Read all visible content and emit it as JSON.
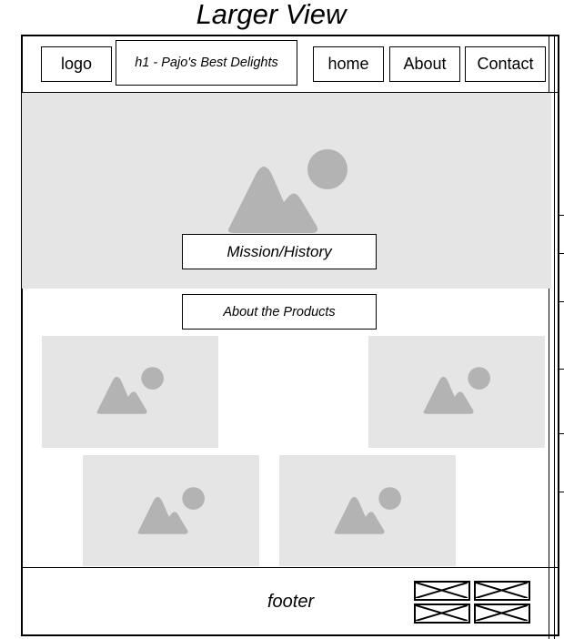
{
  "page": {
    "title": "Larger View"
  },
  "header": {
    "logo_label": "logo",
    "h1_label": "h1 - Pajo's Best Delights",
    "nav": {
      "home": "home",
      "about": "About",
      "contact": "Contact"
    }
  },
  "hero": {
    "image_icon": "image-placeholder-icon",
    "mission_label": "Mission/History"
  },
  "products": {
    "heading": "About the Products",
    "image_icon": "image-placeholder-icon"
  },
  "footer": {
    "label": "footer",
    "social_icons": [
      "crossed-box-icon",
      "crossed-box-icon",
      "crossed-box-icon",
      "crossed-box-icon"
    ]
  },
  "colors": {
    "placeholder_fill": "#e5e5e5",
    "placeholder_icon": "#b3b3b3",
    "stroke": "#000000"
  }
}
